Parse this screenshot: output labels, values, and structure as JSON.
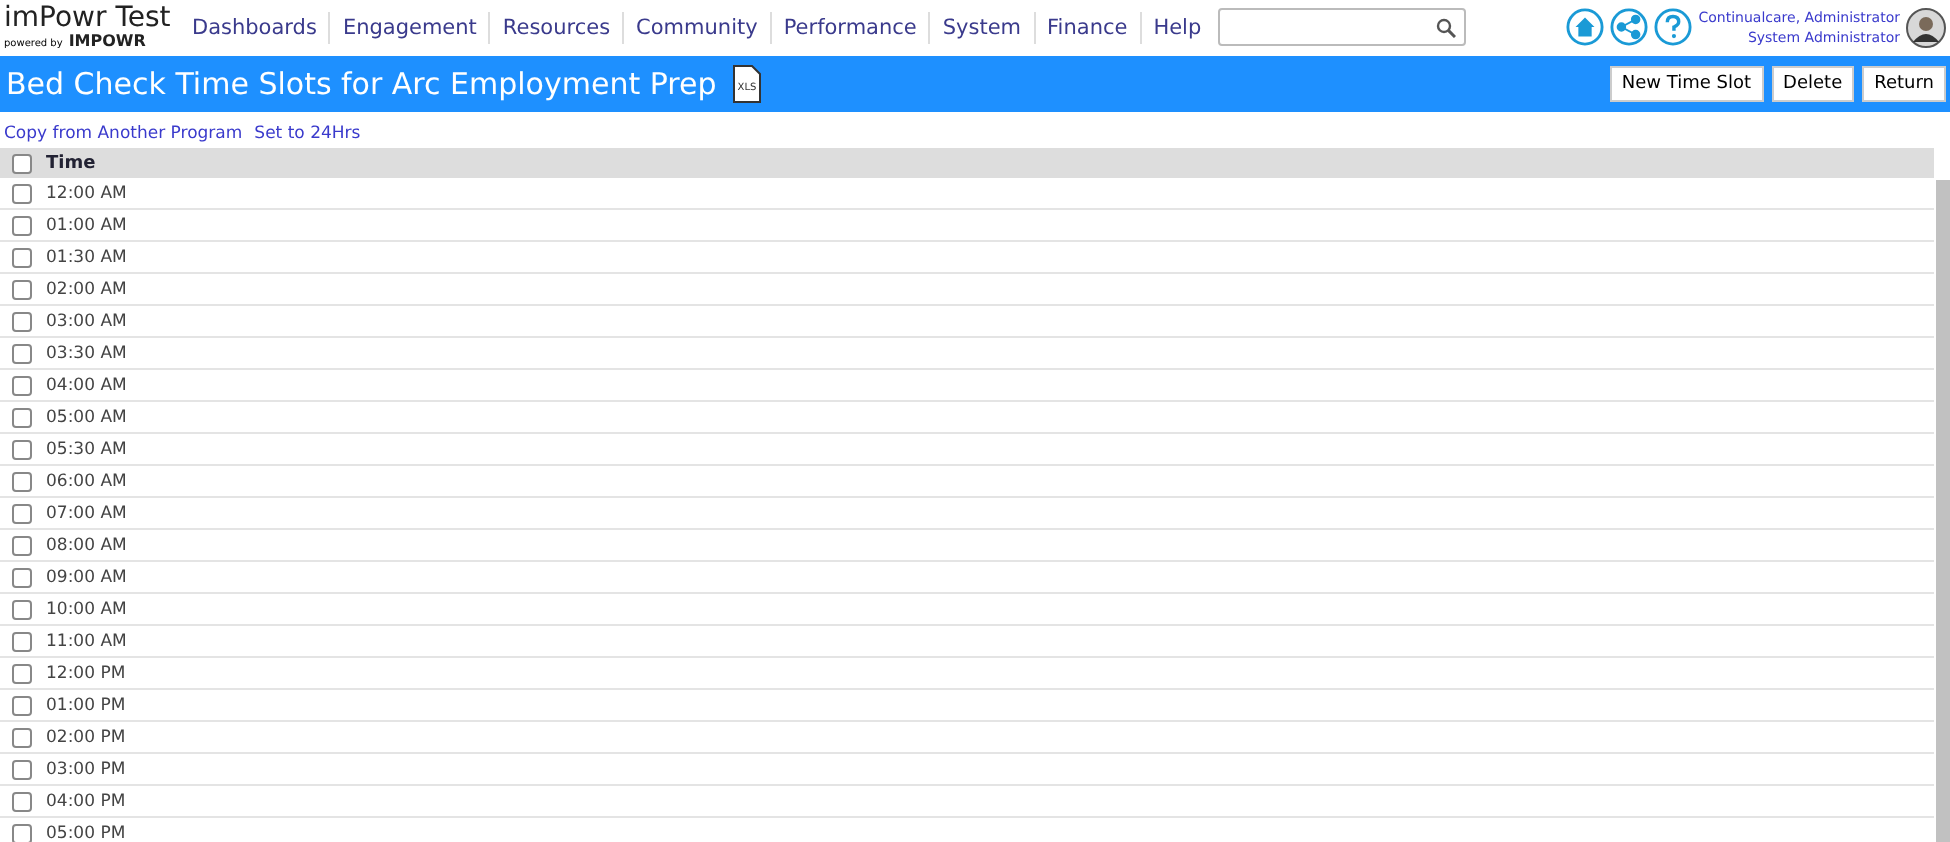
{
  "brand": {
    "title": "imPowr Test",
    "powered_by": "powered by",
    "logo": "IMPOWR"
  },
  "nav": [
    "Dashboards",
    "Engagement",
    "Resources",
    "Community",
    "Performance",
    "System",
    "Finance",
    "Help"
  ],
  "user": {
    "name": "Continualcare, Administrator",
    "role": "System Administrator"
  },
  "page": {
    "title": "Bed Check Time Slots for Arc Employment Prep",
    "export_badge": "XLS",
    "buttons": [
      "New Time Slot",
      "Delete",
      "Return"
    ]
  },
  "links": [
    "Copy from Another Program",
    "Set to 24Hrs"
  ],
  "table": {
    "select_all": {
      "checked": false
    },
    "columns": [
      "Time"
    ],
    "rows": [
      {
        "time": "12:00 AM",
        "checked": false
      },
      {
        "time": "01:00 AM",
        "checked": false
      },
      {
        "time": "01:30 AM",
        "checked": false
      },
      {
        "time": "02:00 AM",
        "checked": false
      },
      {
        "time": "03:00 AM",
        "checked": false
      },
      {
        "time": "03:30 AM",
        "checked": false
      },
      {
        "time": "04:00 AM",
        "checked": false
      },
      {
        "time": "05:00 AM",
        "checked": false
      },
      {
        "time": "05:30 AM",
        "checked": false
      },
      {
        "time": "06:00 AM",
        "checked": false
      },
      {
        "time": "07:00 AM",
        "checked": false
      },
      {
        "time": "08:00 AM",
        "checked": false
      },
      {
        "time": "09:00 AM",
        "checked": false
      },
      {
        "time": "10:00 AM",
        "checked": false
      },
      {
        "time": "11:00 AM",
        "checked": false
      },
      {
        "time": "12:00 PM",
        "checked": false
      },
      {
        "time": "01:00 PM",
        "checked": false
      },
      {
        "time": "02:00 PM",
        "checked": false
      },
      {
        "time": "03:00 PM",
        "checked": false
      },
      {
        "time": "04:00 PM",
        "checked": false
      },
      {
        "time": "05:00 PM",
        "checked": false
      }
    ]
  }
}
